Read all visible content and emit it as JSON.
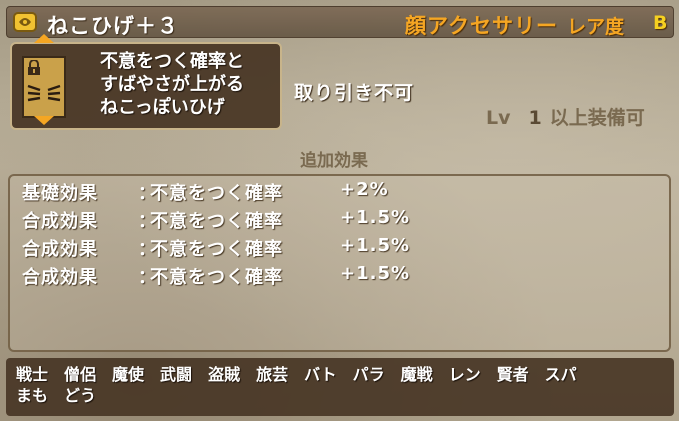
{
  "header": {
    "item_name": "ねこひげ＋３",
    "category": "顔アクセサリー",
    "rarity_label": "レア度",
    "rarity_value": "B"
  },
  "item": {
    "icon": "item-bag-icon",
    "portrait_icon": "cat-whiskers-icon",
    "lock_icon": "lock-icon",
    "description_lines": [
      "不意をつく確率と",
      "すばやさが上がる",
      "ねこっぽいひげ"
    ],
    "trade_status": "取り引き不可",
    "level_label": "Lv",
    "level_value": "1",
    "level_suffix": "以上装備可"
  },
  "effects": {
    "title": "追加効果",
    "rows": [
      {
        "type": "基礎効果",
        "colon": "：",
        "name": "不意をつく確率",
        "value": "+2%"
      },
      {
        "type": "合成効果",
        "colon": "：",
        "name": "不意をつく確率",
        "value": "+1.5%"
      },
      {
        "type": "合成効果",
        "colon": "：",
        "name": "不意をつく確率",
        "value": "+1.5%"
      },
      {
        "type": "合成効果",
        "colon": "：",
        "name": "不意をつく確率",
        "value": "+1.5%"
      }
    ]
  },
  "jobs": [
    "戦士",
    "僧侶",
    "魔使",
    "武闘",
    "盗賊",
    "旅芸",
    "バト",
    "パラ",
    "魔戦",
    "レン",
    "賢者",
    "スパ",
    "まも",
    "どう"
  ],
  "colors": {
    "header_bg": "#6e5a44",
    "category_text": "#f5a623",
    "rarity_text": "#f5d020",
    "panel_dark": "#46341f",
    "portrait_bg": "#caa14a"
  }
}
